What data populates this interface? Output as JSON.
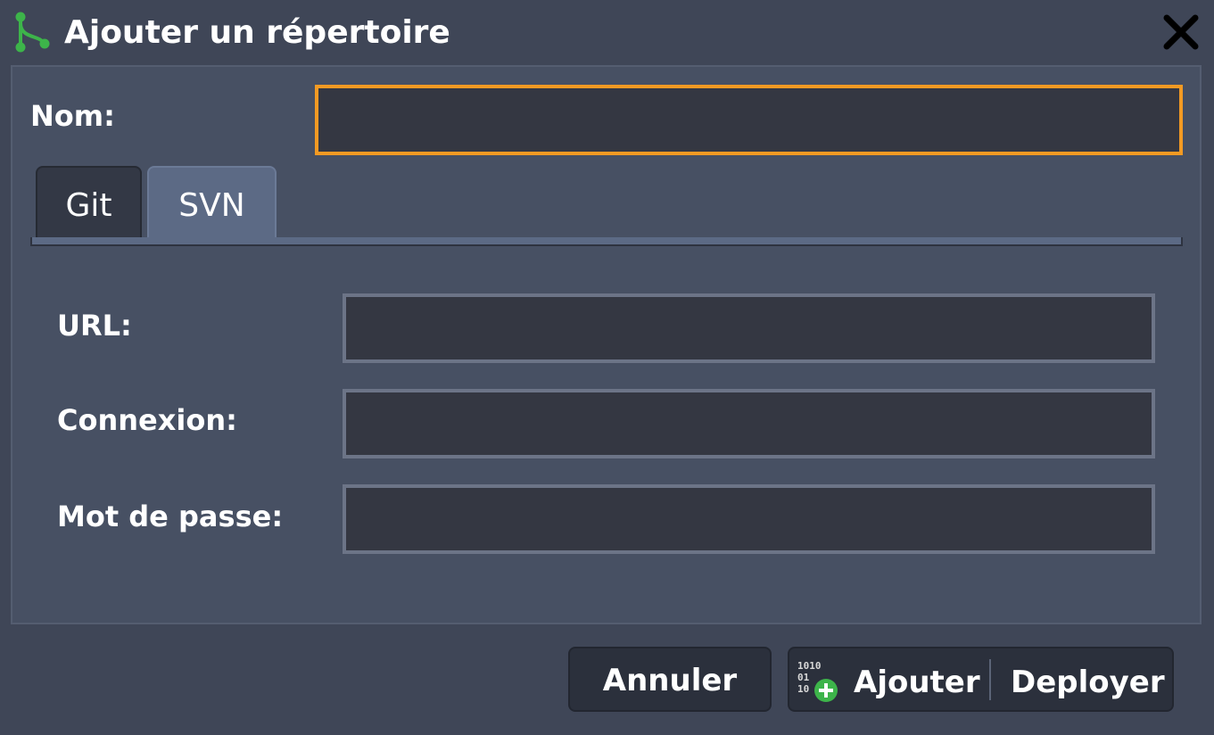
{
  "dialog": {
    "title": "Ajouter un répertoire",
    "title_icon": "git-branch-icon",
    "close_icon": "close-icon"
  },
  "form": {
    "nom_label": "Nom:",
    "nom_value": "",
    "tabs": [
      {
        "label": "Git",
        "active": false
      },
      {
        "label": "SVN",
        "active": true
      }
    ],
    "fields": [
      {
        "label": "URL:",
        "value": ""
      },
      {
        "label": "Connexion:",
        "value": ""
      },
      {
        "label": "Mot de passe:",
        "value": ""
      }
    ]
  },
  "buttons": {
    "cancel_label": "Annuler",
    "add_label": "Ajouter",
    "add_icon": "binary-add-icon",
    "deploy_label": "Deployer"
  },
  "colors": {
    "accent_focus": "#f39a23",
    "icon_green": "#3db44a",
    "background": "#3f4657",
    "panel": "#475063"
  }
}
